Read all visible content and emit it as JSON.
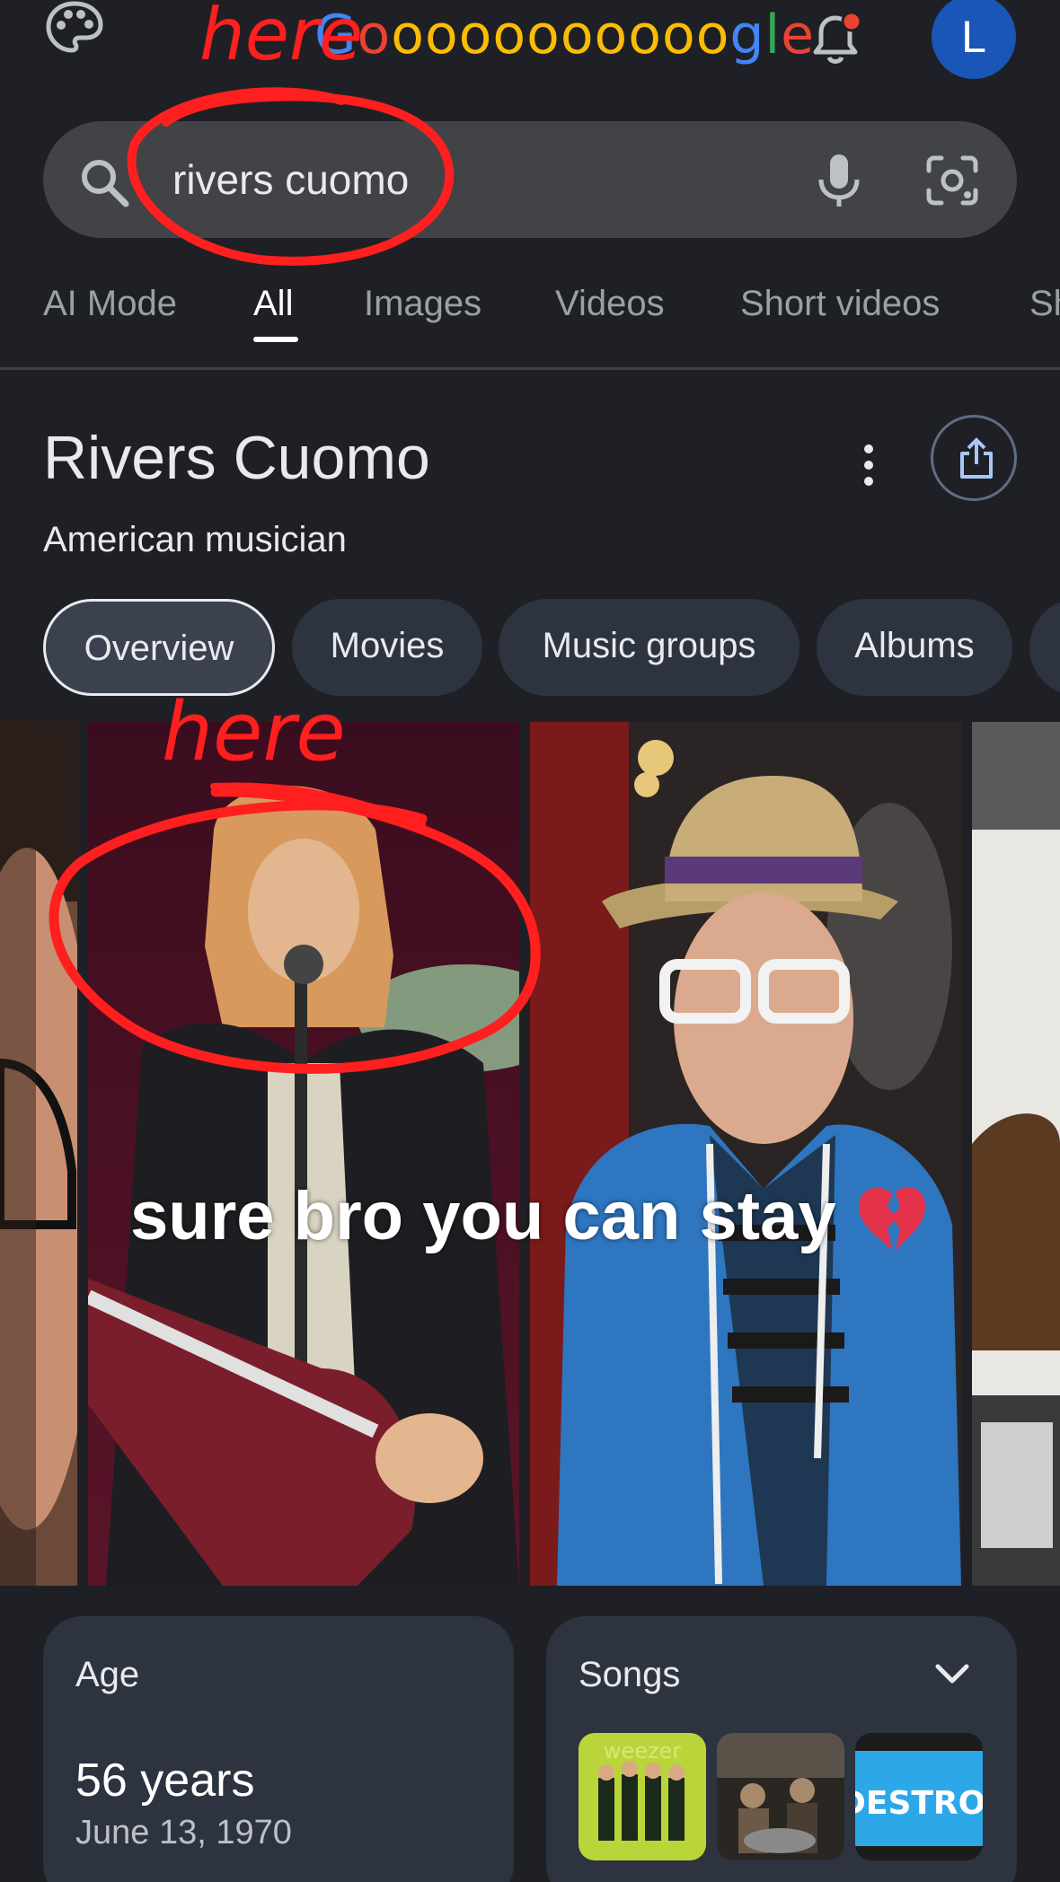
{
  "header": {
    "logo_letters": [
      "G",
      "o",
      "o",
      "o",
      "o",
      "o",
      "o",
      "o",
      "o",
      "o",
      "o",
      "o",
      "g",
      "l",
      "e"
    ],
    "logo_colors": [
      "#4285f4",
      "#ea4335",
      "#fbbc05",
      "#fbbc05",
      "#fbbc05",
      "#fbbc05",
      "#fbbc05",
      "#fbbc05",
      "#fbbc05",
      "#fbbc05",
      "#fbbc05",
      "#fbbc05",
      "#4285f4",
      "#34a853",
      "#ea4335"
    ],
    "avatar_letter": "L",
    "avatar_color": "#1a56b8",
    "notification_dot_color": "#ea4335"
  },
  "search": {
    "query": "rivers cuomo"
  },
  "tabs": [
    {
      "label": "AI Mode",
      "active": false
    },
    {
      "label": "All",
      "active": true
    },
    {
      "label": "Images",
      "active": false
    },
    {
      "label": "Videos",
      "active": false
    },
    {
      "label": "Short videos",
      "active": false
    },
    {
      "label": "Sh",
      "active": false
    }
  ],
  "knowledge_panel": {
    "title": "Rivers Cuomo",
    "subtitle": "American musician",
    "chips": [
      {
        "label": "Overview",
        "selected": true
      },
      {
        "label": "Movies",
        "selected": false
      },
      {
        "label": "Music groups",
        "selected": false
      },
      {
        "label": "Albums",
        "selected": false
      }
    ]
  },
  "meme": {
    "caption": "sure bro you can stay",
    "annotation_word": "here",
    "annotation_color": "#ff1f1f"
  },
  "cards": {
    "age": {
      "label": "Age",
      "value": "56 years",
      "date": "June 13, 1970"
    },
    "songs": {
      "label": "Songs",
      "album_cover_text": "weezer",
      "thumb3_text": "DESTROY"
    }
  },
  "icons": [
    "palette-icon",
    "bell-icon",
    "search-icon",
    "mic-icon",
    "lens-icon",
    "more-icon",
    "share-icon",
    "chevron-down-icon",
    "broken-heart-icon"
  ]
}
